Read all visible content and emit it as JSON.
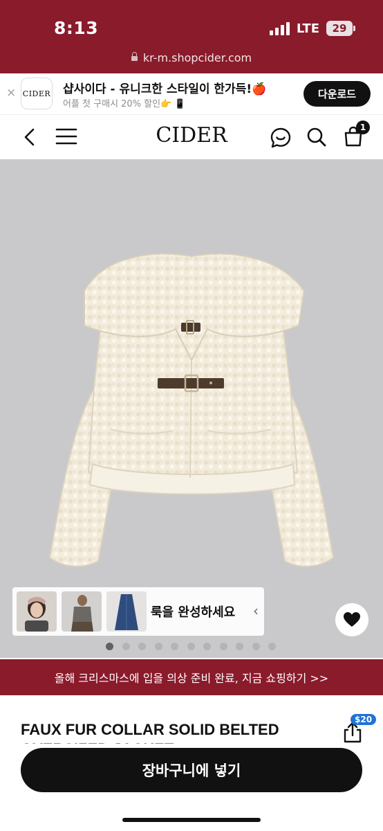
{
  "status_bar": {
    "time": "8:13",
    "network": "LTE",
    "battery": "29"
  },
  "browser": {
    "url": "kr-m.shopcider.com"
  },
  "app_banner": {
    "close": "×",
    "logo_text": "CIDER",
    "title": "샵사이다 - 유니크한 스타일이 한가득!🍎",
    "subtitle": "어플 첫 구매시 20% 할인👉 📱",
    "download_label": "다운로드"
  },
  "nav": {
    "brand": "CIDER",
    "cart_count": "1"
  },
  "lookbook": {
    "text": "룩을 완성하세요",
    "arrow": "‹"
  },
  "carousel": {
    "total": 11,
    "active_index": 0
  },
  "promo": {
    "text": "올해 크리스마스에 입을 의상 준비 완료, 지금 쇼핑하기 >>"
  },
  "product": {
    "title": "FAUX FUR COLLAR SOLID BELTED OVERSIZED JACKET",
    "price_badge": "$20"
  },
  "cart_button": {
    "label": "장바구니에 넣기"
  },
  "colors": {
    "brand_red": "#8a1b2b",
    "dark": "#111111",
    "badge_blue": "#1f73d6"
  },
  "icons": [
    "back-icon",
    "menu-icon",
    "chat-icon",
    "search-icon",
    "bag-icon",
    "heart-icon",
    "share-icon",
    "lock-icon",
    "signal-icon",
    "battery-icon"
  ]
}
